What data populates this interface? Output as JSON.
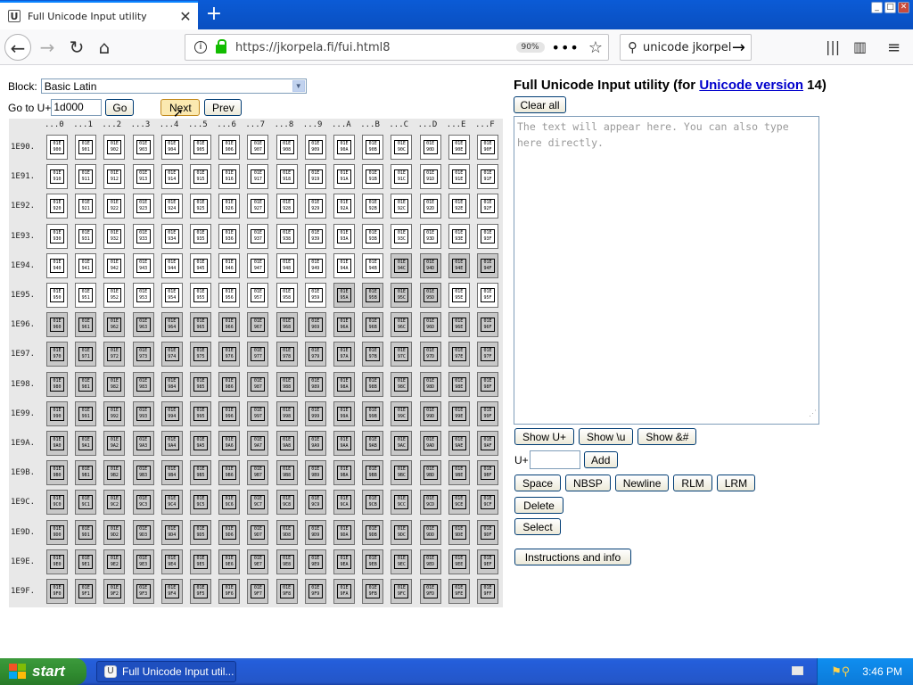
{
  "browser": {
    "tab_title": "Full Unicode Input utility",
    "tab_icon": "U",
    "new_tab": "+",
    "url": "https://jkorpela.fi/fui.html8",
    "zoom": "90%",
    "search_text": "unicode jkorpela"
  },
  "page": {
    "block_label": "Block:",
    "block_value": "Basic Latin",
    "goto_label": "Go to U+",
    "goto_value": "1d000",
    "go_label": "Go",
    "next_label": "Next",
    "prev_label": "Prev"
  },
  "grid": {
    "col_headers": [
      "...0",
      "...1",
      "...2",
      "...3",
      "...4",
      "...5",
      "...6",
      "...7",
      "...8",
      "...9",
      "...A",
      "...B",
      "...C",
      "...D",
      "...E",
      "...F"
    ],
    "rows": [
      {
        "label": "1E90.",
        "prefix": "90"
      },
      {
        "label": "1E91.",
        "prefix": "91"
      },
      {
        "label": "1E92.",
        "prefix": "92"
      },
      {
        "label": "1E93.",
        "prefix": "93"
      },
      {
        "label": "1E94.",
        "prefix": "94"
      },
      {
        "label": "1E95.",
        "prefix": "95"
      },
      {
        "label": "1E96.",
        "prefix": "96"
      },
      {
        "label": "1E97.",
        "prefix": "97"
      },
      {
        "label": "1E98.",
        "prefix": "98"
      },
      {
        "label": "1E99.",
        "prefix": "99"
      },
      {
        "label": "1E9A.",
        "prefix": "9A"
      },
      {
        "label": "1E9B.",
        "prefix": "9B"
      },
      {
        "label": "1E9C.",
        "prefix": "9C"
      },
      {
        "label": "1E9D.",
        "prefix": "9D"
      },
      {
        "label": "1E9E.",
        "prefix": "9E"
      },
      {
        "label": "1E9F.",
        "prefix": "9F"
      }
    ],
    "glyph_top": "01E",
    "gray_cells": {
      "4": [
        12,
        13,
        14,
        15
      ],
      "5": [
        10,
        11,
        12,
        13
      ],
      "6": "all",
      "7": "all",
      "8": "all",
      "9": "all",
      "10": "all",
      "11": "all",
      "12": "all",
      "13": "all",
      "14": "all",
      "15": "all"
    }
  },
  "panel": {
    "title_prefix": "Full Unicode Input utility (for ",
    "title_link": "Unicode version",
    "title_suffix": " 14)",
    "clear_all": "Clear all",
    "textarea_placeholder": "The text will appear here. You can also type here directly.",
    "show_uplus": "Show U+",
    "show_u": "Show \\u",
    "show_amp": "Show &#",
    "uplus_label": "U+",
    "add": "Add",
    "space": "Space",
    "nbsp": "NBSP",
    "newline": "Newline",
    "rlm": "RLM",
    "lrm": "LRM",
    "delete": "Delete",
    "select": "Select",
    "instructions": "Instructions and info"
  },
  "taskbar": {
    "start": "start",
    "task_title": "Full Unicode Input util...",
    "clock": "3:46 PM"
  },
  "colors": {
    "tab_strip": "#0b5bd6",
    "link": "#0000cc",
    "cell_gray": "#c8c8c8",
    "taskbar": "#245edb",
    "start_green": "#2f8a2f"
  }
}
